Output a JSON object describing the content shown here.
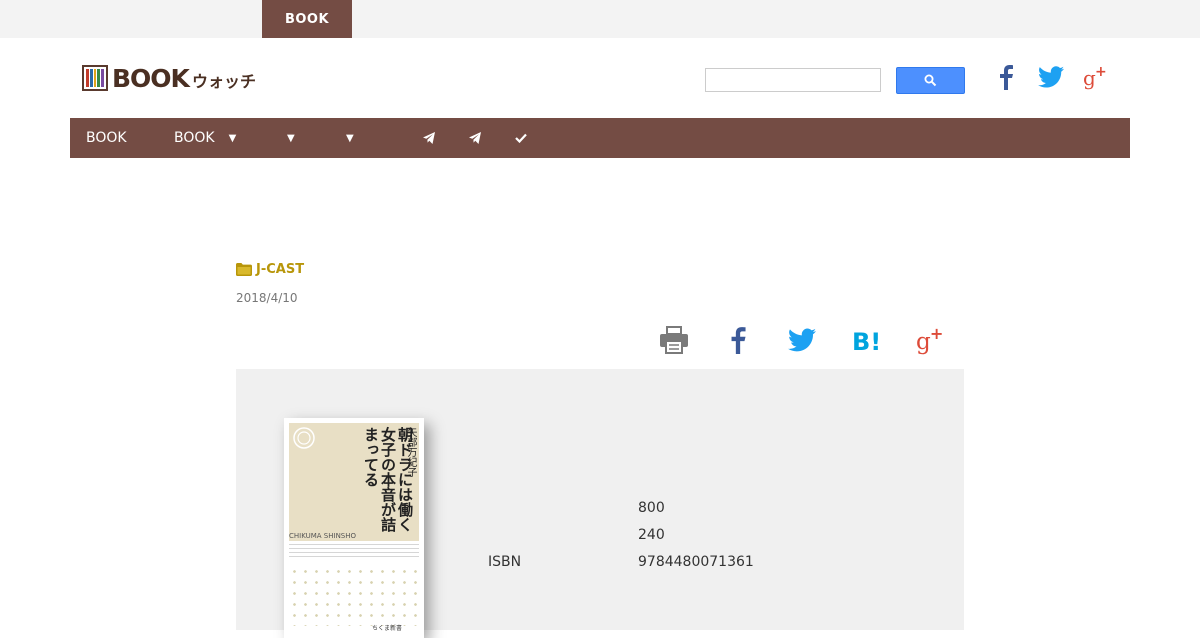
{
  "topbar": {
    "tab_label": "BOOK"
  },
  "logo": {
    "text": "BOOK",
    "sub": "ウォッチ",
    "colors": [
      "#c23b2a",
      "#2e6aa8",
      "#e0a31b",
      "#3a8a44",
      "#7a4aa0"
    ]
  },
  "search": {
    "value": "",
    "button_icon": "magnifier-icon",
    "button_color": "#4d90fe"
  },
  "header_social": [
    {
      "icon": "facebook-icon",
      "color": "#3b5998"
    },
    {
      "icon": "twitter-icon",
      "color": "#1da1f2"
    },
    {
      "icon": "google-plus-icon",
      "color": "#dd4b39"
    }
  ],
  "nav": {
    "background": "#744c44",
    "items": [
      {
        "label": "BOOK",
        "has_arrow": false
      },
      {
        "label": "BOOK",
        "has_arrow": true
      },
      {
        "label": "",
        "has_arrow": true
      },
      {
        "label": "",
        "has_arrow": true
      }
    ],
    "icons": [
      "telegram-icon",
      "telegram-icon",
      "checkmark-icon"
    ]
  },
  "article": {
    "category": "J-CAST",
    "category_icon": "folder-icon",
    "category_color": "#b8960a",
    "date": "2018/4/10"
  },
  "share_icons": [
    "print-icon",
    "facebook-icon",
    "twitter-icon",
    "hatena-bookmark-icon",
    "google-plus-icon"
  ],
  "book": {
    "cover_title": "朝ドラには働く女子の本音が詰まってる",
    "cover_author": "矢部万紀子",
    "cover_series": "CHIKUMA SHINSHO",
    "cover_publisher": "ちくま新書",
    "details": [
      {
        "label": "",
        "value": "800"
      },
      {
        "label": "",
        "value": "240"
      },
      {
        "label": "ISBN",
        "value": "9784480071361"
      }
    ]
  }
}
